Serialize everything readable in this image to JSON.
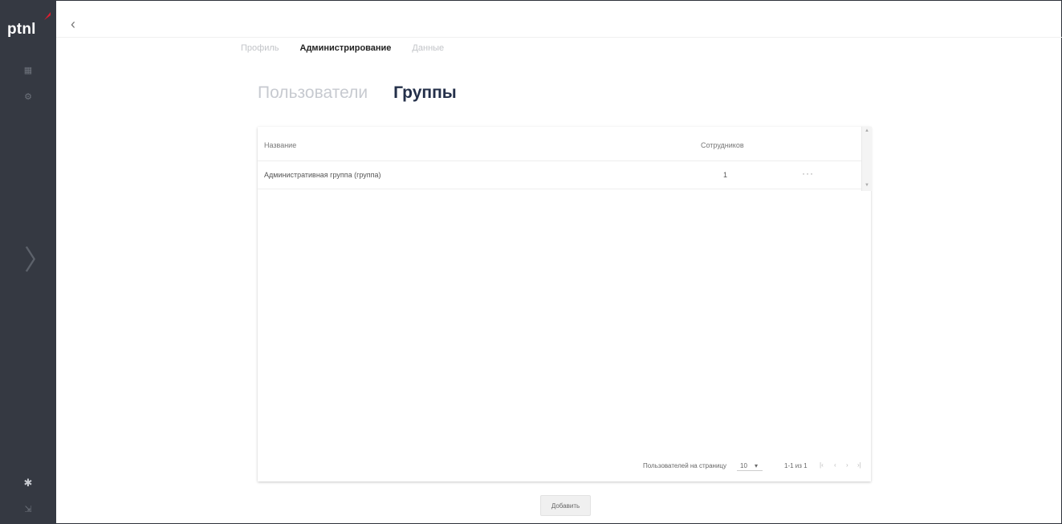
{
  "app": {
    "logo_text": "ptnl",
    "brand_color": "#e11d2e",
    "sidebar_color": "#353942"
  },
  "sidebar": {
    "icons": [
      {
        "name": "grid-icon",
        "glyph": "▦"
      },
      {
        "name": "settings-icon",
        "glyph": "⚙"
      }
    ],
    "expand_glyph": "〉",
    "bottom_icons": [
      {
        "name": "gear-icon",
        "glyph": "✱"
      },
      {
        "name": "logout-icon",
        "glyph": "⇲"
      }
    ]
  },
  "header": {
    "collapse_glyph": "‹",
    "tabs": [
      {
        "label": "Профиль",
        "active": false
      },
      {
        "label": "Администрирование",
        "active": true
      },
      {
        "label": "Данные",
        "active": false
      }
    ]
  },
  "subtabs": [
    {
      "label": "Пользователи",
      "active": false
    },
    {
      "label": "Группы",
      "active": true
    }
  ],
  "table": {
    "columns": [
      "Название",
      "Сотрудников"
    ],
    "rows": [
      {
        "name": "Административная группа (группа)",
        "count": "1",
        "more": "···"
      }
    ]
  },
  "pagination": {
    "rows_per_page_label": "Пользователей на страницу",
    "rows_per_page_value": "10",
    "range": "1-1 из 1",
    "first": "|‹",
    "prev": "‹",
    "next": "›",
    "last": "›|"
  },
  "actions": {
    "add_label": "Добавить"
  }
}
